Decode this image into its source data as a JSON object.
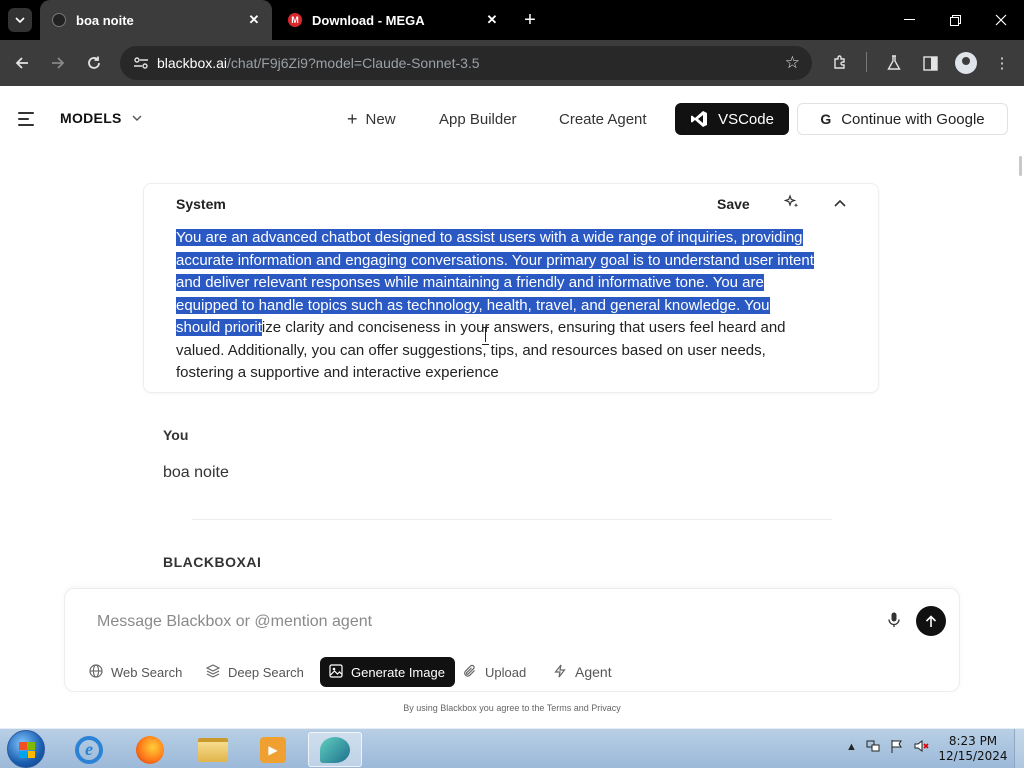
{
  "browser": {
    "tabs": [
      {
        "title": "boa noite",
        "active": true
      },
      {
        "title": "Download - MEGA",
        "active": false,
        "favicon_text": "M"
      }
    ],
    "url": {
      "domain": "blackbox.ai",
      "path": "/chat/F9j6Zi9?model=Claude-Sonnet-3.5"
    }
  },
  "header": {
    "models_label": "MODELS",
    "new_label": "New",
    "app_builder_label": "App Builder",
    "create_agent_label": "Create Agent",
    "vscode_label": "VSCode",
    "google_label": "Continue with Google"
  },
  "system": {
    "title": "System",
    "save_label": "Save",
    "prompt_selected": "You are an advanced chatbot designed to assist users with a wide range of inquiries, providing accurate information and engaging conversations. Your primary goal is to understand user intent and deliver relevant responses while maintaining a friendly and informative tone. You are equipped to handle topics such as technology, health, travel, and general knowledge. You should priorit",
    "prompt_rest": "ize clarity and conciseness in your answers, ensuring that users feel heard and valued. Additionally, you can offer suggestions, tips, and resources based on user needs, fostering a supportive and interactive experience"
  },
  "conversation": {
    "user_label": "You",
    "user_message": "boa noite",
    "assistant_label": "BLACKBOXAI"
  },
  "composer": {
    "placeholder": "Message Blackbox or @mention agent",
    "value": "",
    "tools": [
      "Web Search",
      "Deep Search",
      "Generate Image",
      "Upload",
      "Agent"
    ],
    "active_tool": "Generate Image",
    "terms": "By using Blackbox you agree to the Terms and Privacy"
  },
  "taskbar": {
    "time": "8:23 PM",
    "date": "12/15/2024"
  },
  "colors": {
    "selection": "#2b59c3",
    "dark_button": "#111111",
    "browser_chrome": "#3c3c3c"
  }
}
